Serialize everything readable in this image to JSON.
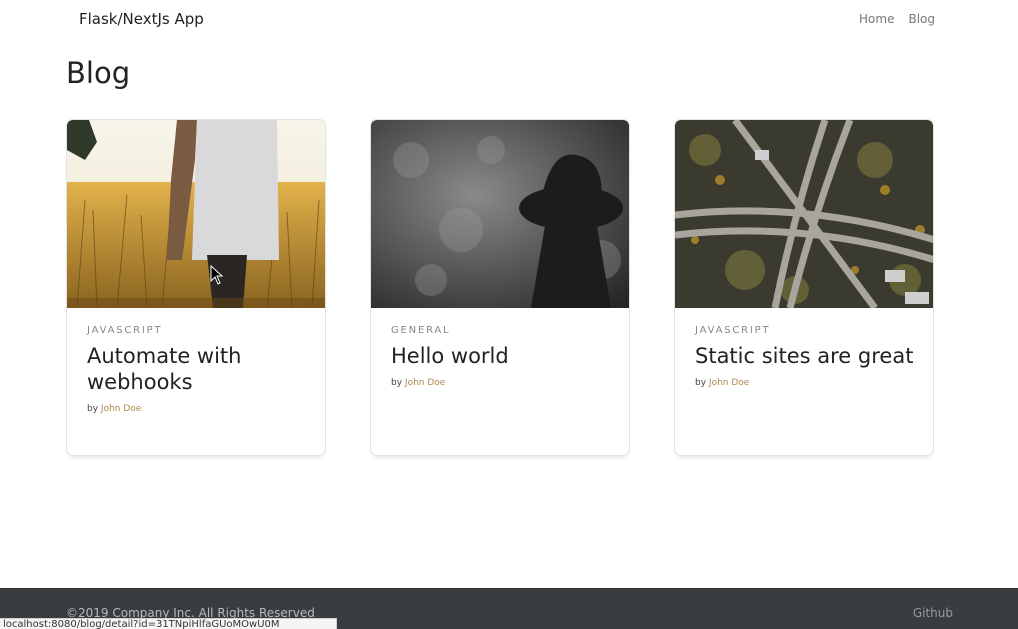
{
  "navbar": {
    "brand": "Flask/NextJs App",
    "links": [
      {
        "label": "Home"
      },
      {
        "label": "Blog"
      }
    ]
  },
  "page": {
    "title": "Blog"
  },
  "posts": [
    {
      "category": "JAVASCRIPT",
      "title": "Automate with webhooks",
      "by": "by",
      "author": "John Doe",
      "image": "wheat-field-photo"
    },
    {
      "category": "GENERAL",
      "title": "Hello world",
      "by": "by",
      "author": "John Doe",
      "image": "silhouette-hat-photo"
    },
    {
      "category": "JAVASCRIPT",
      "title": "Static sites are great",
      "by": "by",
      "author": "John Doe",
      "image": "highway-aerial-photo"
    }
  ],
  "footer": {
    "copyright": "©2019 Company Inc. All Rights Reserved",
    "github_label": "Github",
    "background": "#3a3d40"
  },
  "status_bar": {
    "url": "localhost:8080/blog/detail?id=31TNpiHlfaGUoMOwU0M"
  },
  "colors": {
    "author_link": "#b0894a",
    "muted": "#888888"
  }
}
